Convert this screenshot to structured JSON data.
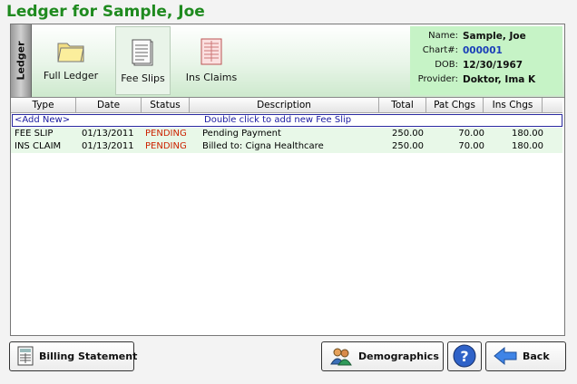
{
  "title": "Ledger for  Sample, Joe",
  "side_tab": "Ledger",
  "toolbar": {
    "full_ledger": "Full Ledger",
    "fee_slips": "Fee Slips",
    "ins_claims": "Ins Claims"
  },
  "patient": {
    "name_label": "Name:",
    "name": "Sample, Joe",
    "chart_label": "Chart#:",
    "chart": "000001",
    "dob_label": "DOB:",
    "dob": "12/30/1967",
    "provider_label": "Provider:",
    "provider": "Doktor, Ima K"
  },
  "grid": {
    "headers": [
      "Type",
      "Date",
      "Status",
      "Description",
      "Total",
      "Pat Chgs",
      "Ins Chgs"
    ],
    "add_new": "<Add New>",
    "add_hint": "Double click to add new Fee Slip",
    "rows": [
      {
        "type": "FEE SLIP",
        "date": "01/13/2011",
        "status": "PENDING",
        "description": "Pending Payment",
        "total": "250.00",
        "pat": "70.00",
        "ins": "180.00"
      },
      {
        "type": "INS CLAIM",
        "date": "01/13/2011",
        "status": "PENDING",
        "description": "Billed to: Cigna Healthcare",
        "total": "250.00",
        "pat": "70.00",
        "ins": "180.00"
      }
    ]
  },
  "buttons": {
    "billing": "Billing Statement",
    "demographics": "Demographics",
    "help": "?",
    "back": "Back"
  },
  "colors": {
    "title_green": "#1f8a1f",
    "info_bg": "#c6f3c6",
    "row_bg": "#e8f8e8",
    "status_red": "#cc2200",
    "chart_blue": "#1a3fb8"
  }
}
